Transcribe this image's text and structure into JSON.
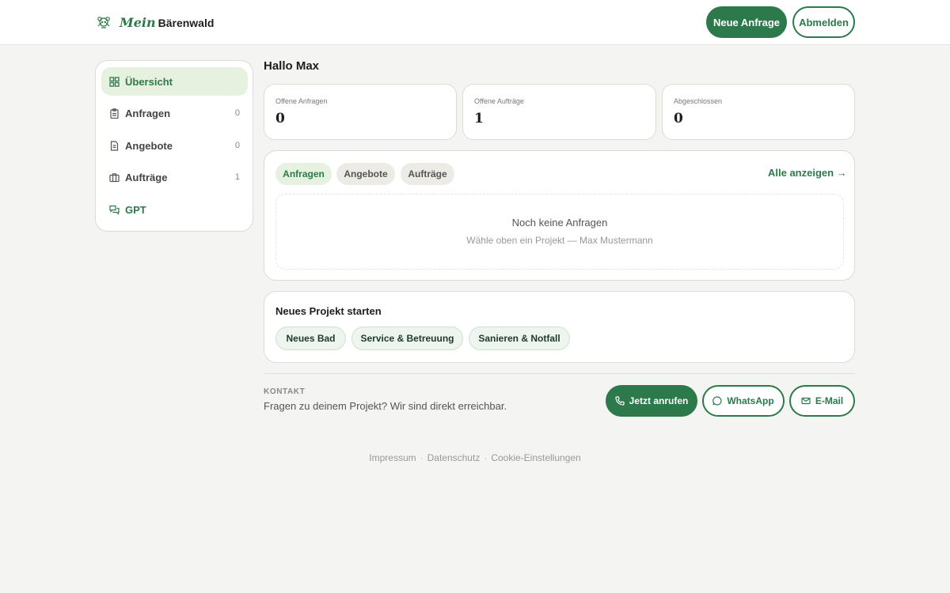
{
  "header": {
    "logo_mein": "Mein",
    "logo_brand": "Bärenwald",
    "new_request": "Neue Anfrage",
    "logout": "Abmelden"
  },
  "sidebar": {
    "items": [
      {
        "label": "Übersicht",
        "count": "",
        "icon": "grid-icon"
      },
      {
        "label": "Anfragen",
        "count": "0",
        "icon": "clipboard-icon"
      },
      {
        "label": "Angebote",
        "count": "0",
        "icon": "document-icon"
      },
      {
        "label": "Aufträge",
        "count": "1",
        "icon": "briefcase-icon"
      },
      {
        "label": "GPT",
        "count": "",
        "icon": "chat-icon"
      }
    ]
  },
  "main": {
    "greeting": "Hallo Max",
    "stats": [
      {
        "label": "Offene Anfragen",
        "value": "0"
      },
      {
        "label": "Offene Aufträge",
        "value": "1"
      },
      {
        "label": "Abgeschlossen",
        "value": "0"
      }
    ],
    "tabs": [
      {
        "label": "Anfragen",
        "active": true
      },
      {
        "label": "Angebote",
        "active": false
      },
      {
        "label": "Aufträge",
        "active": false
      }
    ],
    "show_all": "Alle anzeigen →",
    "empty_title": "Noch keine Anfragen",
    "empty_subtitle": "Wähle oben ein Projekt — Max Mustermann",
    "new_project": {
      "title": "Neues Projekt starten",
      "chips": [
        "Neues Bad",
        "Service & Betreuung",
        "Sanieren & Notfall"
      ]
    }
  },
  "contact": {
    "label": "KONTAKT",
    "text": "Fragen zu deinem Projekt? Wir sind direkt erreichbar.",
    "call": "Jetzt anrufen",
    "whatsapp": "WhatsApp",
    "email": "E-Mail"
  },
  "footer": {
    "links": [
      "Impressum",
      "Datenschutz",
      "Cookie-Einstellungen"
    ]
  },
  "colors": {
    "brand_green": "#2c7a4b",
    "active_bg": "#e6f1e0",
    "page_bg": "#f4f4f2"
  }
}
